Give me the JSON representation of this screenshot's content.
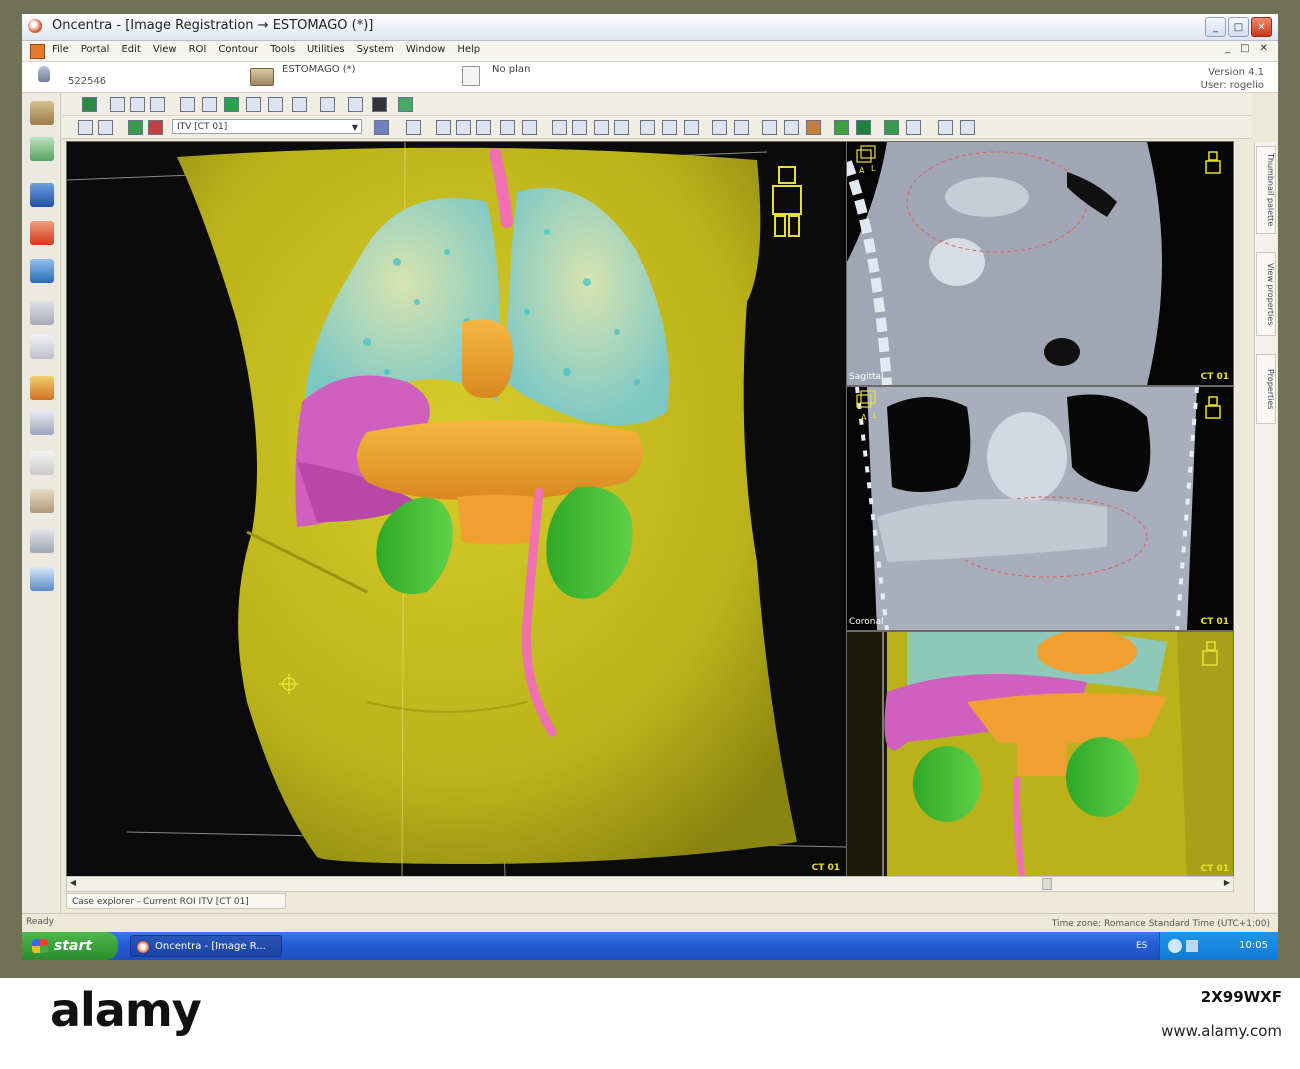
{
  "window": {
    "title": "Oncentra - [Image Registration → ESTOMAGO (*)]",
    "controls": [
      "_",
      "□",
      "✕"
    ]
  },
  "menu": {
    "items": [
      "File",
      "Portal",
      "Edit",
      "View",
      "ROI",
      "Contour",
      "Tools",
      "Utilities",
      "System",
      "Window",
      "Help"
    ],
    "mdi_controls": [
      "_",
      "□",
      "✕"
    ]
  },
  "info": {
    "patient_id": "522546",
    "case_name": "ESTOMAGO (*)",
    "plan": "No plan",
    "version": "Version 4.1",
    "user": "User: rogelio"
  },
  "toolbar": {
    "roi_select": "ITV [CT 01]"
  },
  "side_tabs": [
    "Thumbnail palette",
    "View properties",
    "Properties"
  ],
  "views": {
    "main_3d": {
      "dataset": "CT 01",
      "orientation": [
        "A",
        "L"
      ]
    },
    "sagittal": {
      "name": "Sagittal",
      "dataset": "CT 01",
      "orientation": [
        "A",
        "L"
      ]
    },
    "coronal": {
      "name": "Coronal",
      "dataset": "CT 01",
      "orientation": [
        "A",
        "L"
      ]
    },
    "small_3d": {
      "dataset": "CT 01"
    }
  },
  "explorer": {
    "label": "Case explorer - Current ROI ITV [CT 01]"
  },
  "status": {
    "left": "Ready",
    "right": "Time zone: Romance Standard Time (UTC+1:00)"
  },
  "taskbar": {
    "start": "start",
    "task_item": "Oncentra - [Image R...",
    "language": "ES",
    "clock": "10:05"
  },
  "watermark": {
    "brand": "alamy",
    "image_id": "2X99WXF",
    "url": "www.alamy.com"
  },
  "colors": {
    "body_surface": "#c8c020",
    "lungs": "#8ed0c8",
    "liver": "#d060c0",
    "stomach_itv": "#f0a030",
    "kidneys": "#40c030",
    "spinal_cord": "#f070b0",
    "view_label": "#e8e030"
  }
}
